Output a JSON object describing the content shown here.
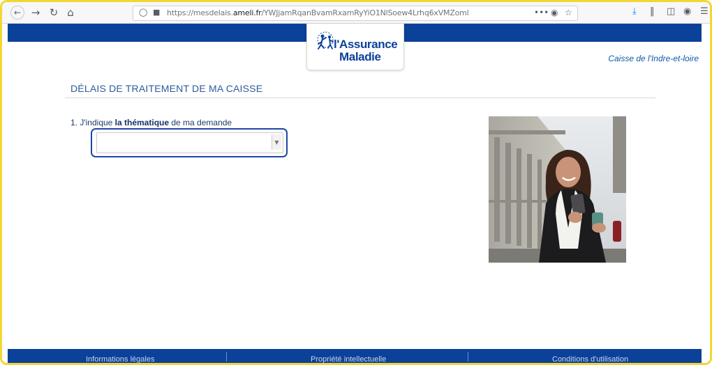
{
  "browser": {
    "url_prefix": "https://mesdelais.",
    "url_domain": "ameli.fr",
    "url_path": "/YWJjamRqanBvamRxamRyYiO1NlSoew4Lrhq6xVMZoml",
    "more_icon": "•••",
    "icons": [
      "back-arrow-icon",
      "forward-arrow-icon",
      "reload-icon",
      "home-icon",
      "shield-icon",
      "lock-icon",
      "pocket-icon",
      "star-icon",
      "download-icon",
      "library-icon",
      "sidebar-icon",
      "account-icon",
      "menu-icon"
    ]
  },
  "site": {
    "logo_line1": "l'Assurance",
    "logo_line2": "Maladie",
    "caisse": "Caisse de l'Indre-et-loire",
    "brand_color": "#0c419a"
  },
  "main": {
    "title": "DÉLAIS DE TRAITEMENT DE MA CAISSE",
    "step_prefix": "1. J'indique ",
    "step_bold": "la thématique",
    "step_suffix": " de ma demande",
    "select_value": ""
  },
  "footer": {
    "items": [
      "Informations légales",
      "Propriété intellectuelle",
      "Conditions d'utilisation"
    ]
  }
}
